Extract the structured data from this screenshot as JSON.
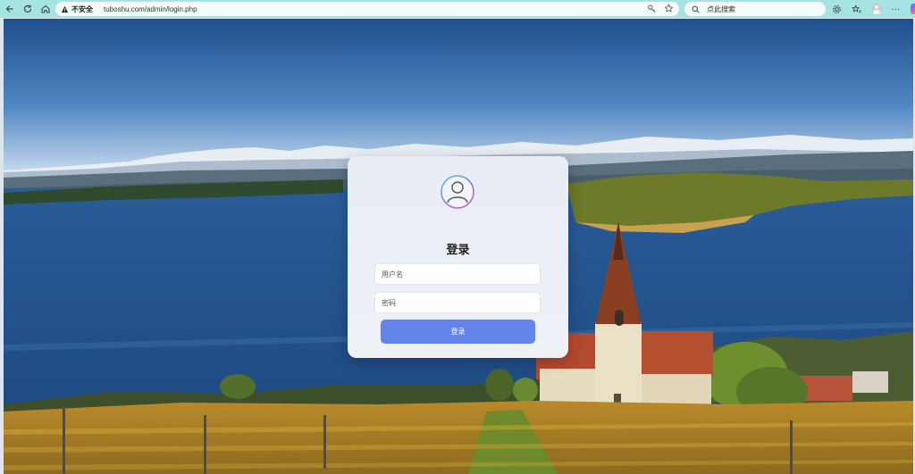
{
  "browser": {
    "security_label": "不安全",
    "url": "tuboshu.com/admin/login.php",
    "search_placeholder": "点此搜索"
  },
  "login": {
    "title": "登录",
    "username_placeholder": "用户名",
    "password_placeholder": "密码",
    "submit_label": "登录"
  },
  "colors": {
    "chrome": "#a6e3e3",
    "button": "#6384e8",
    "card": "#eef1f6"
  }
}
